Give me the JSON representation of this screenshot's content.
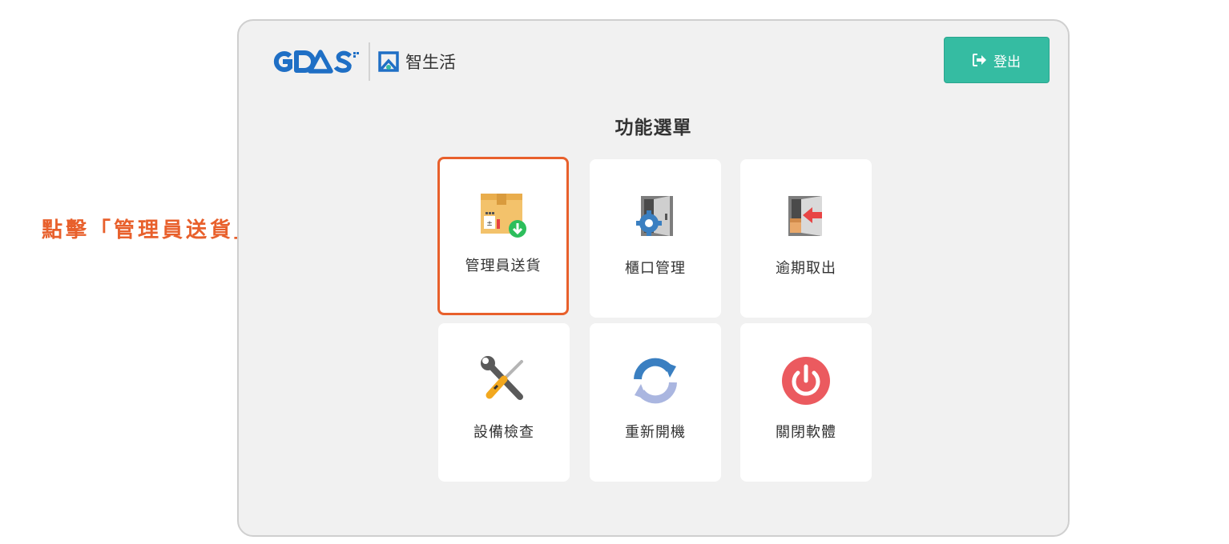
{
  "annotation": {
    "text": "點擊「管理員送貨」"
  },
  "header": {
    "brand_name": "智生活",
    "logout_label": "登出"
  },
  "menu": {
    "title": "功能選單",
    "items": [
      {
        "label": "管理員送貨",
        "icon": "package-download-icon"
      },
      {
        "label": "櫃口管理",
        "icon": "locker-gear-icon"
      },
      {
        "label": "逾期取出",
        "icon": "locker-retrieve-icon"
      },
      {
        "label": "設備檢查",
        "icon": "tools-icon"
      },
      {
        "label": "重新開機",
        "icon": "restart-icon"
      },
      {
        "label": "關閉軟體",
        "icon": "power-icon"
      }
    ]
  },
  "colors": {
    "accent": "#35bca2",
    "highlight": "#e8602c",
    "background": "#f1f1f1"
  }
}
